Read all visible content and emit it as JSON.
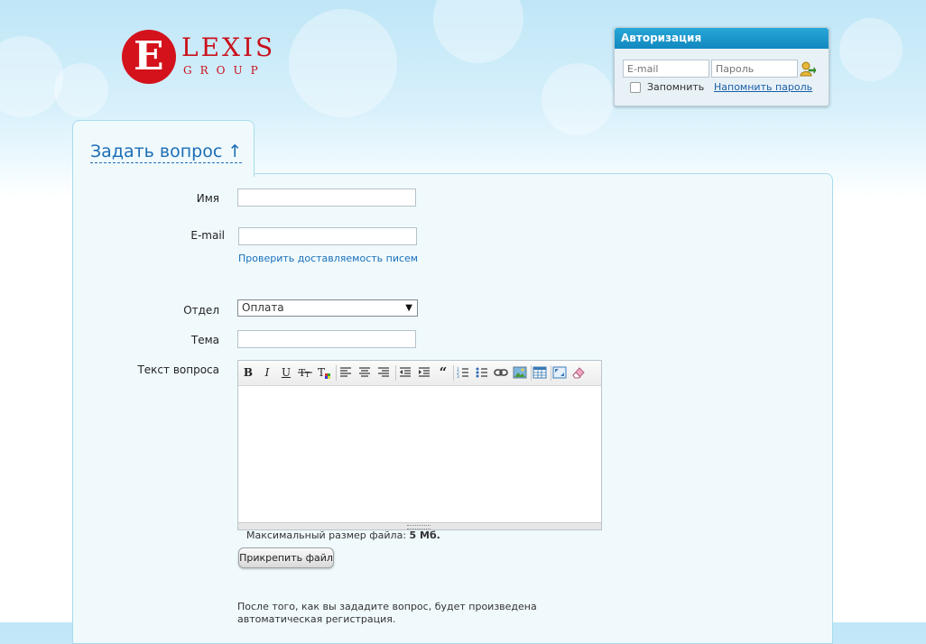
{
  "logo": {
    "letter": "E",
    "word": "LEXIS",
    "sub": "GROUP"
  },
  "auth": {
    "title": "Авторизация",
    "email_placeholder": "E-mail",
    "password_placeholder": "Пароль",
    "remember_label": "Запомнить",
    "forgot_link": "Напомнить пароль"
  },
  "tab": {
    "title": "Задать вопрос ↑"
  },
  "form": {
    "name_label": "Имя",
    "email_label": "E-mail",
    "check_delivery_link": "Проверить доставляемость писем",
    "department_label": "Отдел",
    "department_selected": "Оплата",
    "subject_label": "Тема",
    "question_label": "Текст вопроса",
    "max_size_text": "Максимальный размер файла:",
    "max_size_value": "5 Мб.",
    "attach_button": "Прикрепить файл",
    "notice": "После того, как вы зададите вопрос, будет произведена автоматическая регистрация."
  },
  "editor_toolbar": {
    "bold": "B",
    "italic": "I",
    "underline": "U",
    "quote": "“"
  },
  "colors": {
    "accent": "#1288bf",
    "link": "#1a6fba",
    "logo_red": "#d4121c"
  }
}
